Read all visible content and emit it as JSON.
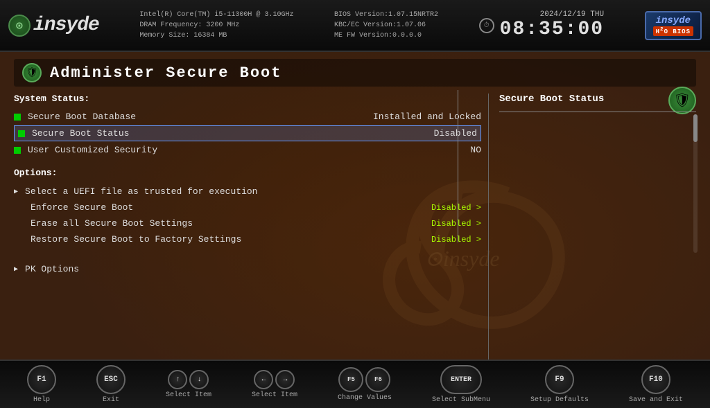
{
  "header": {
    "logo_symbol": "⊙",
    "logo_name": "insyde",
    "cpu_info": "Intel(R) Core(TM) i5-11300H @ 3.10GHz",
    "dram_info": "DRAM Frequency: 3200 MHz",
    "memory_info": "Memory Size: 16384 MB",
    "bios_version": "BIOS Version:1.07.15NRTR2",
    "kbc_version": "KBC/EC Version:1.07.06",
    "me_version": "ME FW Version:0.0.0.0",
    "date": "2024/12/19",
    "day": "THU",
    "time": "08:35:00",
    "insyde_brand": "insyde",
    "insyde_badge": "H2O BIOS"
  },
  "page": {
    "title": "Administer Secure Boot",
    "shield_icon": "🛡"
  },
  "system_status": {
    "label": "System Status:",
    "items": [
      {
        "name": "Secure Boot Database",
        "value": "Installed and Locked"
      },
      {
        "name": "Secure Boot Status",
        "value": "Disabled"
      },
      {
        "name": "User Customized Security",
        "value": "NO"
      }
    ]
  },
  "options": {
    "label": "Options:",
    "items": [
      {
        "name": "Select a UEFI file as trusted for execution",
        "value": "",
        "has_arrow": true
      },
      {
        "name": "Enforce Secure Boot",
        "value": "Disabled >",
        "has_arrow": false
      },
      {
        "name": "Erase all Secure Boot Settings",
        "value": "Disabled >",
        "has_arrow": false
      },
      {
        "name": "Restore Secure Boot to Factory Settings",
        "value": "Disabled >",
        "has_arrow": false
      }
    ]
  },
  "pk_options": {
    "name": "PK Options",
    "has_arrow": true
  },
  "right_panel": {
    "title": "Secure Boot Status"
  },
  "function_keys": [
    {
      "key": "F1",
      "label": "Help"
    },
    {
      "key": "ESC",
      "label": "Exit"
    },
    {
      "key": "↑↓",
      "label": "Select Item"
    },
    {
      "key": "←→",
      "label": "Select Item"
    },
    {
      "key": "F5 F6",
      "label": "Change Values"
    },
    {
      "key": "ENTER",
      "label": "Select SubMenu"
    },
    {
      "key": "F9",
      "label": "Setup Defaults"
    },
    {
      "key": "F10",
      "label": "Save and Exit"
    }
  ]
}
